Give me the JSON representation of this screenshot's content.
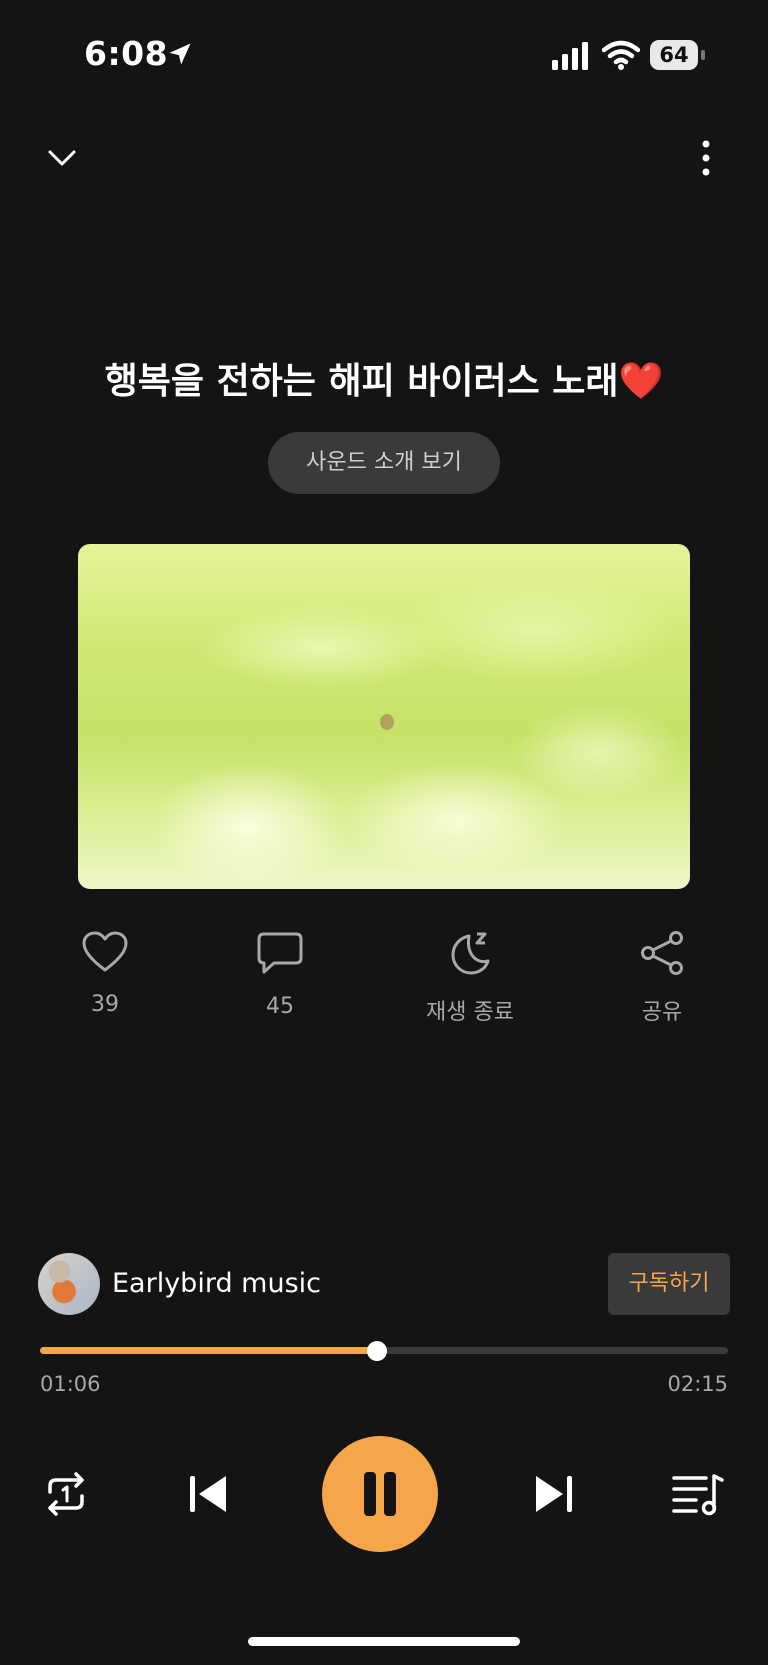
{
  "status_bar": {
    "time": "6:08",
    "battery": "64"
  },
  "header": {
    "title": "행복을 전하는 해피 바이러스 노래❤️",
    "intro_button": "사운드 소개 보기"
  },
  "actions": {
    "like_count": "39",
    "comment_count": "45",
    "sleep_timer_label": "재생 종료",
    "share_label": "공유"
  },
  "channel": {
    "name": "Earlybird music",
    "subscribe_label": "구독하기"
  },
  "player": {
    "current_time": "01:06",
    "total_time": "02:15",
    "progress_fraction": 0.49
  },
  "colors": {
    "accent": "#f5a54a",
    "background": "#141414"
  },
  "icons": [
    "chevron-down-icon",
    "more-vertical-icon",
    "heart-icon",
    "comment-icon",
    "moon-sleep-icon",
    "share-icon",
    "repeat-one-icon",
    "skip-previous-icon",
    "pause-icon",
    "skip-next-icon",
    "playlist-icon"
  ]
}
